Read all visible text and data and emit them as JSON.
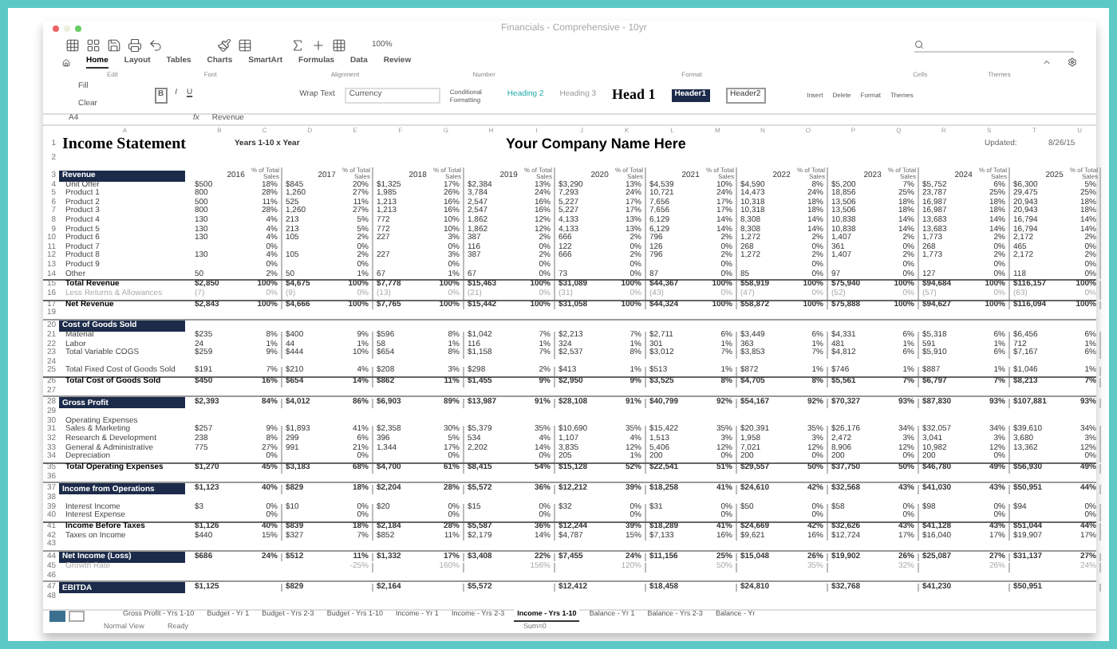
{
  "window": {
    "title": "Financials - Comprehensive - 10yr"
  },
  "toolbar": {
    "zoom": "100%"
  },
  "tabs": [
    {
      "label": "Home",
      "selected": true
    },
    {
      "label": "Layout",
      "selected": false
    },
    {
      "label": "Tables",
      "selected": false
    },
    {
      "label": "Charts",
      "selected": false
    },
    {
      "label": "SmartArt",
      "selected": false
    },
    {
      "label": "Formulas",
      "selected": false
    },
    {
      "label": "Data",
      "selected": false
    },
    {
      "label": "Review",
      "selected": false
    }
  ],
  "ribbon": {
    "groups": [
      "Edit",
      "Font",
      "Alignment",
      "Number",
      "Format",
      "Cells",
      "Themes"
    ],
    "edit": [
      "Fill",
      "Clear"
    ],
    "font_buttons": [
      "B",
      "I",
      "U"
    ],
    "wrap": "Wrap Text",
    "number_format": "Currency",
    "conditional": "Conditional Formatting",
    "styles": [
      {
        "label": "Heading 2",
        "kind": "teal"
      },
      {
        "label": "Heading 3",
        "kind": "plain"
      },
      {
        "label": "Head 1",
        "kind": "big"
      },
      {
        "label": "Header1",
        "kind": "dark"
      },
      {
        "label": "Header2",
        "kind": "box"
      }
    ],
    "cells": [
      "Insert",
      "Delete",
      "Format"
    ],
    "themes": "Themes"
  },
  "formula_bar": {
    "cell": "A4",
    "fx": "fx",
    "content": "Revenue"
  },
  "columns": [
    "A",
    "B",
    "C",
    "D",
    "E",
    "F",
    "G",
    "H",
    "I",
    "J",
    "K",
    "L",
    "M",
    "N",
    "O",
    "P",
    "Q",
    "R",
    "S",
    "T",
    "U"
  ],
  "sheet": {
    "title": "Income Statement",
    "period": "Years 1-10 x Year",
    "company": "Your Company Name Here",
    "updated_label": "Updated:",
    "updated": "8/26/15"
  },
  "years": [
    {
      "year": "2016",
      "pct_label": "% of Total Sales"
    },
    {
      "year": "2017",
      "pct_label": "% of Total Sales"
    },
    {
      "year": "2018",
      "pct_label": "% of Total Sales"
    },
    {
      "year": "2019",
      "pct_label": "% of Total Sales"
    },
    {
      "year": "2020",
      "pct_label": "% of Total Sales"
    },
    {
      "year": "2021",
      "pct_label": "% of Total Sales"
    },
    {
      "year": "2022",
      "pct_label": "% of Total Sales"
    },
    {
      "year": "2023",
      "pct_label": "% of Total Sales"
    },
    {
      "year": "2024",
      "pct_label": "% of Total Sales"
    },
    {
      "year": "2025",
      "pct_label": "% of Total Sales"
    }
  ],
  "rows": [
    {
      "n": "1",
      "kind": "title"
    },
    {
      "n": "2",
      "kind": "blank"
    },
    {
      "n": "3",
      "kind": "header",
      "label": "Revenue"
    },
    {
      "n": "4",
      "kind": "item",
      "label": "Unit Offer",
      "cells": [
        [
          "$",
          "500",
          "18%"
        ],
        [
          "$",
          "845",
          "20%"
        ],
        [
          "$",
          "1,325",
          "17%"
        ],
        [
          "$",
          "2,384",
          "13%"
        ],
        [
          "$",
          "3,290",
          "13%"
        ],
        [
          "$",
          "4,539",
          "10%"
        ],
        [
          "$",
          "4,590",
          "8%"
        ],
        [
          "$",
          "5,200",
          "7%"
        ],
        [
          "$",
          "5,752",
          "6%"
        ],
        [
          "$",
          "6,300",
          "5%"
        ]
      ]
    },
    {
      "n": "5",
      "kind": "item",
      "label": "Product 1",
      "cells": [
        [
          null,
          "800",
          "28%"
        ],
        [
          null,
          "1,260",
          "27%"
        ],
        [
          null,
          "1,985",
          "26%"
        ],
        [
          null,
          "3,784",
          "24%"
        ],
        [
          null,
          "7,293",
          "24%"
        ],
        [
          null,
          "10,721",
          "24%"
        ],
        [
          null,
          "14,473",
          "24%"
        ],
        [
          null,
          "18,856",
          "25%"
        ],
        [
          null,
          "23,787",
          "25%"
        ],
        [
          null,
          "29,475",
          "25%"
        ]
      ]
    },
    {
      "n": "6",
      "kind": "item",
      "label": "Product 2",
      "cells": [
        [
          null,
          "500",
          "11%"
        ],
        [
          null,
          "525",
          "11%"
        ],
        [
          null,
          "1,213",
          "16%"
        ],
        [
          null,
          "2,547",
          "16%"
        ],
        [
          null,
          "5,227",
          "17%"
        ],
        [
          null,
          "7,656",
          "17%"
        ],
        [
          null,
          "10,318",
          "18%"
        ],
        [
          null,
          "13,506",
          "18%"
        ],
        [
          null,
          "16,987",
          "18%"
        ],
        [
          null,
          "20,943",
          "18%"
        ]
      ]
    },
    {
      "n": "7",
      "kind": "item",
      "label": "Product 3",
      "cells": [
        [
          null,
          "800",
          "28%"
        ],
        [
          null,
          "1,260",
          "27%"
        ],
        [
          null,
          "1,213",
          "16%"
        ],
        [
          null,
          "2,547",
          "16%"
        ],
        [
          null,
          "5,227",
          "17%"
        ],
        [
          null,
          "7,656",
          "17%"
        ],
        [
          null,
          "10,318",
          "18%"
        ],
        [
          null,
          "13,506",
          "18%"
        ],
        [
          null,
          "16,987",
          "18%"
        ],
        [
          null,
          "20,943",
          "18%"
        ]
      ]
    },
    {
      "n": "8",
      "kind": "item",
      "label": "Product 4",
      "cells": [
        [
          null,
          "130",
          "4%"
        ],
        [
          null,
          "213",
          "5%"
        ],
        [
          null,
          "772",
          "10%"
        ],
        [
          null,
          "1,862",
          "12%"
        ],
        [
          null,
          "4,133",
          "13%"
        ],
        [
          null,
          "6,129",
          "14%"
        ],
        [
          null,
          "8,308",
          "14%"
        ],
        [
          null,
          "10,838",
          "14%"
        ],
        [
          null,
          "13,683",
          "14%"
        ],
        [
          null,
          "16,794",
          "14%"
        ]
      ]
    },
    {
      "n": "9",
      "kind": "item",
      "label": "Product 5",
      "cells": [
        [
          null,
          "130",
          "4%"
        ],
        [
          null,
          "213",
          "5%"
        ],
        [
          null,
          "772",
          "10%"
        ],
        [
          null,
          "1,862",
          "12%"
        ],
        [
          null,
          "4,133",
          "13%"
        ],
        [
          null,
          "6,129",
          "14%"
        ],
        [
          null,
          "8,308",
          "14%"
        ],
        [
          null,
          "10,838",
          "14%"
        ],
        [
          null,
          "13,683",
          "14%"
        ],
        [
          null,
          "16,794",
          "14%"
        ]
      ]
    },
    {
      "n": "10",
      "kind": "item",
      "label": "Product 6",
      "cells": [
        [
          null,
          "130",
          "4%"
        ],
        [
          null,
          "105",
          "2%"
        ],
        [
          null,
          "227",
          "3%"
        ],
        [
          null,
          "387",
          "2%"
        ],
        [
          null,
          "666",
          "2%"
        ],
        [
          null,
          "796",
          "2%"
        ],
        [
          null,
          "1,272",
          "2%"
        ],
        [
          null,
          "1,407",
          "2%"
        ],
        [
          null,
          "1,773",
          "2%"
        ],
        [
          null,
          "2,172",
          "2%"
        ]
      ]
    },
    {
      "n": "11",
      "kind": "item",
      "label": "Product 7",
      "cells": [
        [
          null,
          null,
          "0%"
        ],
        [
          null,
          null,
          "0%"
        ],
        [
          null,
          null,
          "0%"
        ],
        [
          null,
          "116",
          "0%"
        ],
        [
          null,
          "122",
          "0%"
        ],
        [
          null,
          "126",
          "0%"
        ],
        [
          null,
          "268",
          "0%"
        ],
        [
          null,
          "361",
          "0%"
        ],
        [
          null,
          "268",
          "0%"
        ],
        [
          null,
          "465",
          "0%"
        ]
      ]
    },
    {
      "n": "12",
      "kind": "item",
      "label": "Product 8",
      "cells": [
        [
          null,
          "130",
          "4%"
        ],
        [
          null,
          "105",
          "2%"
        ],
        [
          null,
          "227",
          "3%"
        ],
        [
          null,
          "387",
          "2%"
        ],
        [
          null,
          "666",
          "2%"
        ],
        [
          null,
          "796",
          "2%"
        ],
        [
          null,
          "1,272",
          "2%"
        ],
        [
          null,
          "1,407",
          "2%"
        ],
        [
          null,
          "1,773",
          "2%"
        ],
        [
          null,
          "2,172",
          "2%"
        ]
      ]
    },
    {
      "n": "13",
      "kind": "item",
      "label": "Product 9",
      "cells": [
        [
          null,
          null,
          "0%"
        ],
        [
          null,
          null,
          "0%"
        ],
        [
          null,
          null,
          "0%"
        ],
        [
          null,
          null,
          "0%"
        ],
        [
          null,
          null,
          "0%"
        ],
        [
          null,
          null,
          "0%"
        ],
        [
          null,
          null,
          "0%"
        ],
        [
          null,
          null,
          "0%"
        ],
        [
          null,
          null,
          "0%"
        ],
        [
          null,
          null,
          "0%"
        ]
      ]
    },
    {
      "n": "14",
      "kind": "item",
      "label": "Other",
      "cells": [
        [
          null,
          "50",
          "2%"
        ],
        [
          null,
          "50",
          "1%"
        ],
        [
          null,
          "67",
          "1%"
        ],
        [
          null,
          "67",
          "0%"
        ],
        [
          null,
          "73",
          "0%"
        ],
        [
          null,
          "87",
          "0%"
        ],
        [
          null,
          "85",
          "0%"
        ],
        [
          null,
          "97",
          "0%"
        ],
        [
          null,
          "127",
          "0%"
        ],
        [
          null,
          "118",
          "0%"
        ]
      ]
    },
    {
      "n": "15",
      "kind": "total",
      "label": "Total Revenue",
      "cells": [
        [
          "$",
          "2,850",
          "100%"
        ],
        [
          "$",
          "4,675",
          "100%"
        ],
        [
          "$",
          "7,778",
          "100%"
        ],
        [
          "$",
          "15,463",
          "100%"
        ],
        [
          "$",
          "31,089",
          "100%"
        ],
        [
          "$",
          "44,367",
          "100%"
        ],
        [
          "$",
          "58,919",
          "100%"
        ],
        [
          "$",
          "75,940",
          "100%"
        ],
        [
          "$",
          "94,684",
          "100%"
        ],
        [
          "$",
          "116,157",
          "100%"
        ]
      ]
    },
    {
      "n": "16",
      "kind": "faint",
      "label": "Less Returns & Allowances",
      "cells": [
        [
          null,
          "(7)",
          "0%"
        ],
        [
          null,
          "(9)",
          "0%"
        ],
        [
          null,
          "(13)",
          "0%"
        ],
        [
          null,
          "(21)",
          "0%"
        ],
        [
          null,
          "(31)",
          "0%"
        ],
        [
          null,
          "(43)",
          "0%"
        ],
        [
          null,
          "(47)",
          "0%"
        ],
        [
          null,
          "(52)",
          "0%"
        ],
        [
          null,
          "(57)",
          "0%"
        ],
        [
          null,
          "(63)",
          "0%"
        ]
      ]
    },
    {
      "n": "17",
      "kind": "total",
      "label": "Net Revenue",
      "cells": [
        [
          "$",
          "2,843",
          "100%"
        ],
        [
          "$",
          "4,666",
          "100%"
        ],
        [
          "$",
          "7,765",
          "100%"
        ],
        [
          "$",
          "15,442",
          "100%"
        ],
        [
          "$",
          "31,058",
          "100%"
        ],
        [
          "$",
          "44,324",
          "100%"
        ],
        [
          "$",
          "58,872",
          "100%"
        ],
        [
          "$",
          "75,888",
          "100%"
        ],
        [
          "$",
          "94,627",
          "100%"
        ],
        [
          "$",
          "116,094",
          "100%"
        ]
      ]
    },
    {
      "n": "19",
      "kind": "blank"
    },
    {
      "n": "20",
      "kind": "section",
      "label": "Cost of Goods Sold"
    },
    {
      "n": "21",
      "kind": "item",
      "label": "Material",
      "cells": [
        [
          "$",
          "235",
          "8%"
        ],
        [
          "$",
          "400",
          "9%"
        ],
        [
          "$",
          "596",
          "8%"
        ],
        [
          "$",
          "1,042",
          "7%"
        ],
        [
          "$",
          "2,213",
          "7%"
        ],
        [
          "$",
          "2,711",
          "6%"
        ],
        [
          "$",
          "3,449",
          "6%"
        ],
        [
          "$",
          "4,331",
          "6%"
        ],
        [
          "$",
          "5,318",
          "6%"
        ],
        [
          "$",
          "6,456",
          "6%"
        ]
      ]
    },
    {
      "n": "22",
      "kind": "item",
      "label": "Labor",
      "cells": [
        [
          null,
          "24",
          "1%"
        ],
        [
          null,
          "44",
          "1%"
        ],
        [
          null,
          "58",
          "1%"
        ],
        [
          null,
          "116",
          "1%"
        ],
        [
          null,
          "324",
          "1%"
        ],
        [
          null,
          "301",
          "1%"
        ],
        [
          null,
          "363",
          "1%"
        ],
        [
          null,
          "481",
          "1%"
        ],
        [
          null,
          "591",
          "1%"
        ],
        [
          null,
          "712",
          "1%"
        ]
      ]
    },
    {
      "n": "23",
      "kind": "item",
      "label": "Total Variable COGS",
      "cells": [
        [
          "$",
          "259",
          "9%"
        ],
        [
          "$",
          "444",
          "10%"
        ],
        [
          "$",
          "654",
          "8%"
        ],
        [
          "$",
          "1,158",
          "7%"
        ],
        [
          "$",
          "2,537",
          "8%"
        ],
        [
          "$",
          "3,012",
          "7%"
        ],
        [
          "$",
          "3,853",
          "7%"
        ],
        [
          "$",
          "4,812",
          "6%"
        ],
        [
          "$",
          "5,910",
          "6%"
        ],
        [
          "$",
          "7,167",
          "6%"
        ]
      ]
    },
    {
      "n": "24",
      "kind": "blank"
    },
    {
      "n": "25",
      "kind": "item",
      "label": "Total Fixed Cost of Goods Sold",
      "cells": [
        [
          "$",
          "191",
          "7%"
        ],
        [
          "$",
          "210",
          "4%"
        ],
        [
          "$",
          "208",
          "3%"
        ],
        [
          "$",
          "298",
          "2%"
        ],
        [
          "$",
          "413",
          "1%"
        ],
        [
          "$",
          "513",
          "1%"
        ],
        [
          "$",
          "872",
          "1%"
        ],
        [
          "$",
          "746",
          "1%"
        ],
        [
          "$",
          "887",
          "1%"
        ],
        [
          "$",
          "1,046",
          "1%"
        ]
      ]
    },
    {
      "n": "26",
      "kind": "total",
      "label": "Total Cost of Goods Sold",
      "cells": [
        [
          "$",
          "450",
          "16%"
        ],
        [
          "$",
          "654",
          "14%"
        ],
        [
          "$",
          "862",
          "11%"
        ],
        [
          "$",
          "1,455",
          "9%"
        ],
        [
          "$",
          "2,950",
          "9%"
        ],
        [
          "$",
          "3,525",
          "8%"
        ],
        [
          "$",
          "4,705",
          "8%"
        ],
        [
          "$",
          "5,561",
          "7%"
        ],
        [
          "$",
          "6,797",
          "7%"
        ],
        [
          "$",
          "8,213",
          "7%"
        ]
      ]
    },
    {
      "n": "27",
      "kind": "blank"
    },
    {
      "n": "28",
      "kind": "section",
      "label": "Gross Profit",
      "cells": [
        [
          "$",
          "2,393",
          "84%"
        ],
        [
          "$",
          "4,012",
          "86%"
        ],
        [
          "$",
          "6,903",
          "89%"
        ],
        [
          "$",
          "13,987",
          "91%"
        ],
        [
          "$",
          "28,108",
          "91%"
        ],
        [
          "$",
          "40,799",
          "92%"
        ],
        [
          "$",
          "54,167",
          "92%"
        ],
        [
          "$",
          "70,327",
          "93%"
        ],
        [
          "$",
          "87,830",
          "93%"
        ],
        [
          "$",
          "107,881",
          "93%"
        ]
      ]
    },
    {
      "n": "29",
      "kind": "blank"
    },
    {
      "n": "30",
      "kind": "item",
      "label": "Operating Expenses"
    },
    {
      "n": "31",
      "kind": "item",
      "label": "Sales & Marketing",
      "cells": [
        [
          "$",
          "257",
          "9%"
        ],
        [
          "$",
          "1,893",
          "41%"
        ],
        [
          "$",
          "2,358",
          "30%"
        ],
        [
          "$",
          "5,379",
          "35%"
        ],
        [
          "$",
          "10,690",
          "35%"
        ],
        [
          "$",
          "15,422",
          "35%"
        ],
        [
          "$",
          "20,391",
          "35%"
        ],
        [
          "$",
          "26,176",
          "34%"
        ],
        [
          "$",
          "32,057",
          "34%"
        ],
        [
          "$",
          "39,610",
          "34%"
        ]
      ]
    },
    {
      "n": "32",
      "kind": "item",
      "label": "Research & Development",
      "cells": [
        [
          null,
          "238",
          "8%"
        ],
        [
          null,
          "299",
          "6%"
        ],
        [
          null,
          "396",
          "5%"
        ],
        [
          null,
          "534",
          "4%"
        ],
        [
          null,
          "1,107",
          "4%"
        ],
        [
          null,
          "1,513",
          "3%"
        ],
        [
          null,
          "1,958",
          "3%"
        ],
        [
          null,
          "2,472",
          "3%"
        ],
        [
          null,
          "3,041",
          "3%"
        ],
        [
          null,
          "3,680",
          "3%"
        ]
      ]
    },
    {
      "n": "33",
      "kind": "item",
      "label": "General & Administrative",
      "cells": [
        [
          null,
          "775",
          "27%"
        ],
        [
          null,
          "991",
          "21%"
        ],
        [
          null,
          "1,344",
          "17%"
        ],
        [
          null,
          "2,202",
          "14%"
        ],
        [
          null,
          "3,835",
          "12%"
        ],
        [
          null,
          "5,406",
          "12%"
        ],
        [
          null,
          "7,021",
          "12%"
        ],
        [
          null,
          "8,906",
          "12%"
        ],
        [
          null,
          "10,982",
          "12%"
        ],
        [
          null,
          "13,362",
          "12%"
        ]
      ]
    },
    {
      "n": "34",
      "kind": "item",
      "label": "Depreciation",
      "cells": [
        [
          null,
          null,
          "0%"
        ],
        [
          null,
          null,
          "0%"
        ],
        [
          null,
          null,
          "0%"
        ],
        [
          null,
          null,
          "0%"
        ],
        [
          null,
          "205",
          "1%"
        ],
        [
          null,
          "200",
          "0%"
        ],
        [
          null,
          "200",
          "0%"
        ],
        [
          null,
          "200",
          "0%"
        ],
        [
          null,
          "200",
          "0%"
        ],
        [
          null,
          null,
          "0%"
        ]
      ]
    },
    {
      "n": "35",
      "kind": "total",
      "label": "Total Operating Expenses",
      "cells": [
        [
          "$",
          "1,270",
          "45%"
        ],
        [
          "$",
          "3,183",
          "68%"
        ],
        [
          "$",
          "4,700",
          "61%"
        ],
        [
          "$",
          "8,415",
          "54%"
        ],
        [
          "$",
          "15,128",
          "52%"
        ],
        [
          "$",
          "22,541",
          "51%"
        ],
        [
          "$",
          "29,557",
          "50%"
        ],
        [
          "$",
          "37,750",
          "50%"
        ],
        [
          "$",
          "46,780",
          "49%"
        ],
        [
          "$",
          "56,930",
          "49%"
        ]
      ]
    },
    {
      "n": "36",
      "kind": "blank"
    },
    {
      "n": "37",
      "kind": "section",
      "label": "Income from Operations",
      "cells": [
        [
          "$",
          "1,123",
          "40%"
        ],
        [
          "$",
          "829",
          "18%"
        ],
        [
          "$",
          "2,204",
          "28%"
        ],
        [
          "$",
          "5,572",
          "36%"
        ],
        [
          "$",
          "12,212",
          "39%"
        ],
        [
          "$",
          "18,258",
          "41%"
        ],
        [
          "$",
          "24,610",
          "42%"
        ],
        [
          "$",
          "32,568",
          "43%"
        ],
        [
          "$",
          "41,030",
          "43%"
        ],
        [
          "$",
          "50,951",
          "44%"
        ]
      ]
    },
    {
      "n": "38",
      "kind": "blank"
    },
    {
      "n": "39",
      "kind": "item",
      "label": "Interest Income",
      "cells": [
        [
          "$",
          "3",
          "0%"
        ],
        [
          "$",
          "10",
          "0%"
        ],
        [
          "$",
          "20",
          "0%"
        ],
        [
          "$",
          "15",
          "0%"
        ],
        [
          "$",
          "32",
          "0%"
        ],
        [
          "$",
          "31",
          "0%"
        ],
        [
          "$",
          "50",
          "0%"
        ],
        [
          "$",
          "58",
          "0%"
        ],
        [
          "$",
          "98",
          "0%"
        ],
        [
          "$",
          "94",
          "0%"
        ]
      ]
    },
    {
      "n": "40",
      "kind": "item",
      "label": "Interest Expense",
      "cells": [
        [
          null,
          null,
          "0%"
        ],
        [
          null,
          null,
          "0%"
        ],
        [
          null,
          null,
          "0%"
        ],
        [
          null,
          null,
          "0%"
        ],
        [
          null,
          null,
          "0%"
        ],
        [
          null,
          null,
          "0%"
        ],
        [
          null,
          null,
          "0%"
        ],
        [
          null,
          null,
          "0%"
        ],
        [
          null,
          null,
          "0%"
        ],
        [
          null,
          null,
          "0%"
        ]
      ]
    },
    {
      "n": "41",
      "kind": "total",
      "label": "Income Before Taxes",
      "cells": [
        [
          "$",
          "1,126",
          "40%"
        ],
        [
          "$",
          "839",
          "18%"
        ],
        [
          "$",
          "2,184",
          "28%"
        ],
        [
          "$",
          "5,587",
          "36%"
        ],
        [
          "$",
          "12,244",
          "39%"
        ],
        [
          "$",
          "18,289",
          "41%"
        ],
        [
          "$",
          "24,669",
          "42%"
        ],
        [
          "$",
          "32,626",
          "43%"
        ],
        [
          "$",
          "41,128",
          "43%"
        ],
        [
          "$",
          "51,044",
          "44%"
        ]
      ]
    },
    {
      "n": "42",
      "kind": "item",
      "label": "Taxes on Income",
      "cells": [
        [
          "$",
          "440",
          "15%"
        ],
        [
          "$",
          "327",
          "7%"
        ],
        [
          "$",
          "852",
          "11%"
        ],
        [
          "$",
          "2,179",
          "14%"
        ],
        [
          "$",
          "4,787",
          "15%"
        ],
        [
          "$",
          "7,133",
          "16%"
        ],
        [
          "$",
          "9,621",
          "16%"
        ],
        [
          "$",
          "12,724",
          "17%"
        ],
        [
          "$",
          "16,040",
          "17%"
        ],
        [
          "$",
          "19,907",
          "17%"
        ]
      ]
    },
    {
      "n": "43",
      "kind": "blank"
    },
    {
      "n": "44",
      "kind": "section",
      "label": "Net Income (Loss)",
      "cells": [
        [
          "$",
          "686",
          "24%"
        ],
        [
          "$",
          "512",
          "11%"
        ],
        [
          "$",
          "1,332",
          "17%"
        ],
        [
          "$",
          "3,408",
          "22%"
        ],
        [
          "$",
          "7,455",
          "24%"
        ],
        [
          "$",
          "11,156",
          "25%"
        ],
        [
          "$",
          "15,048",
          "26%"
        ],
        [
          "$",
          "19,902",
          "26%"
        ],
        [
          "$",
          "25,087",
          "27%"
        ],
        [
          "$",
          "31,137",
          "27%"
        ]
      ]
    },
    {
      "n": "45",
      "kind": "faint",
      "label": "Growth Rate",
      "cells": [
        [
          null,
          null,
          null
        ],
        [
          null,
          null,
          "-25%"
        ],
        [
          null,
          null,
          "160%"
        ],
        [
          null,
          null,
          "156%"
        ],
        [
          null,
          null,
          "120%"
        ],
        [
          null,
          null,
          "50%"
        ],
        [
          null,
          null,
          "35%"
        ],
        [
          null,
          null,
          "32%"
        ],
        [
          null,
          null,
          "26%"
        ],
        [
          null,
          null,
          "24%"
        ]
      ]
    },
    {
      "n": "46",
      "kind": "blank"
    },
    {
      "n": "47",
      "kind": "section",
      "label": "EBITDA",
      "cells": [
        [
          "$",
          "1,125",
          null
        ],
        [
          "$",
          "829",
          null
        ],
        [
          "$",
          "2,164",
          null
        ],
        [
          "$",
          "5,572",
          null
        ],
        [
          "$",
          "12,412",
          null
        ],
        [
          "$",
          "18,458",
          null
        ],
        [
          "$",
          "24,810",
          null
        ],
        [
          "$",
          "32,768",
          null
        ],
        [
          "$",
          "41,230",
          null
        ],
        [
          "$",
          "50,951",
          null
        ]
      ]
    },
    {
      "n": "48",
      "kind": "blank"
    }
  ],
  "sheet_tabs": [
    {
      "label": "Gross Profit - Yrs 1-10",
      "selected": false
    },
    {
      "label": "Budget - Yr 1",
      "selected": false
    },
    {
      "label": "Budget - Yrs 2-3",
      "selected": false
    },
    {
      "label": "Budget - Yrs 1-10",
      "selected": false
    },
    {
      "label": "Income - Yr 1",
      "selected": false
    },
    {
      "label": "Income - Yrs 2-3",
      "selected": false
    },
    {
      "label": "Income - Yrs 1-10",
      "selected": true
    },
    {
      "label": "Balance - Yr 1",
      "selected": false
    },
    {
      "label": "Balance - Yrs 2-3",
      "selected": false
    },
    {
      "label": "Balance - Yr",
      "selected": false
    }
  ],
  "status_bar": {
    "view": "Normal View",
    "state": "Ready",
    "sum": "Sum=0"
  }
}
